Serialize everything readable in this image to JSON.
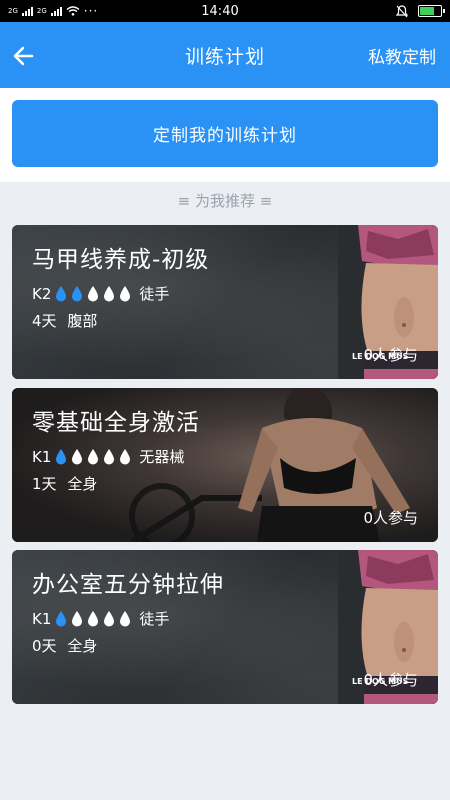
{
  "status_bar": {
    "sim1": "2G",
    "sim2": "2G",
    "dots": "···",
    "time": "14:40"
  },
  "app_bar": {
    "title": "训练计划",
    "action": "私教定制"
  },
  "cta": {
    "label": "定制我的训练计划"
  },
  "section": {
    "label": "≡ 为我推荐 ≡"
  },
  "colors": {
    "primary": "#2b92f5",
    "drop_filled": "#2b92f5",
    "drop_empty": "#ffffff"
  },
  "plans": [
    {
      "title": "马甲线养成-初级",
      "level": "K2",
      "difficulty_filled": 2,
      "difficulty_total": 5,
      "equipment": "徒手",
      "duration": "4天",
      "body_part": "腹部",
      "participants": "0人参与",
      "waistband_text": "LE DOG   MUS"
    },
    {
      "title": "零基础全身激活",
      "level": "K1",
      "difficulty_filled": 1,
      "difficulty_total": 5,
      "equipment": "无器械",
      "duration": "1天",
      "body_part": "全身",
      "participants": "0人参与"
    },
    {
      "title": "办公室五分钟拉伸",
      "level": "K1",
      "difficulty_filled": 1,
      "difficulty_total": 5,
      "equipment": "徒手",
      "duration": "0天",
      "body_part": "全身",
      "participants": "0人参与",
      "waistband_text": "LE DOG   MUS"
    }
  ]
}
